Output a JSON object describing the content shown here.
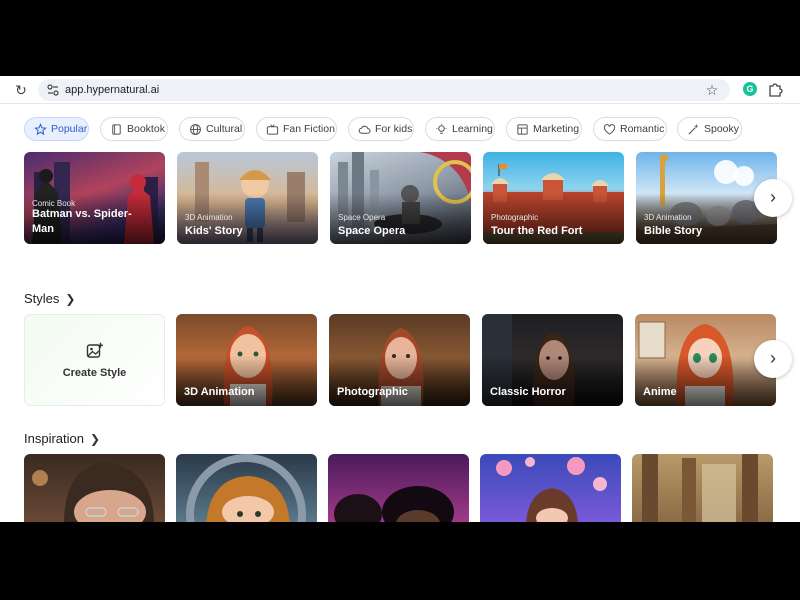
{
  "browser": {
    "url": "app.hypernatural.ai"
  },
  "chips": [
    {
      "label": "Popular",
      "icon": "star-icon",
      "active": true
    },
    {
      "label": "Booktok",
      "icon": "book-icon"
    },
    {
      "label": "Cultural",
      "icon": "globe-icon"
    },
    {
      "label": "Fan Fiction",
      "icon": "tv-icon"
    },
    {
      "label": "For kids",
      "icon": "cloud-icon"
    },
    {
      "label": "Learning",
      "icon": "lightbulb-icon"
    },
    {
      "label": "Marketing",
      "icon": "layout-icon"
    },
    {
      "label": "Romantic",
      "icon": "heart-icon"
    },
    {
      "label": "Spooky",
      "icon": "wand-icon"
    }
  ],
  "featured": [
    {
      "subtitle": "Comic Book",
      "title": "Batman vs. Spider-Man"
    },
    {
      "subtitle": "3D Animation",
      "title": "Kids' Story"
    },
    {
      "subtitle": "Space Opera",
      "title": "Space Opera"
    },
    {
      "subtitle": "Photographic",
      "title": "Tour the Red Fort"
    },
    {
      "subtitle": "3D Animation",
      "title": "Bible Story"
    }
  ],
  "styles": {
    "heading": "Styles",
    "create_label": "Create Style",
    "items": [
      {
        "title": "3D Animation"
      },
      {
        "title": "Photographic"
      },
      {
        "title": "Classic Horror"
      },
      {
        "title": "Anime"
      }
    ]
  },
  "inspiration": {
    "heading": "Inspiration"
  },
  "colors": {
    "accent": "#2f5dcc",
    "chip_active_bg": "#e8efff",
    "grammarly": "#15c39a"
  }
}
